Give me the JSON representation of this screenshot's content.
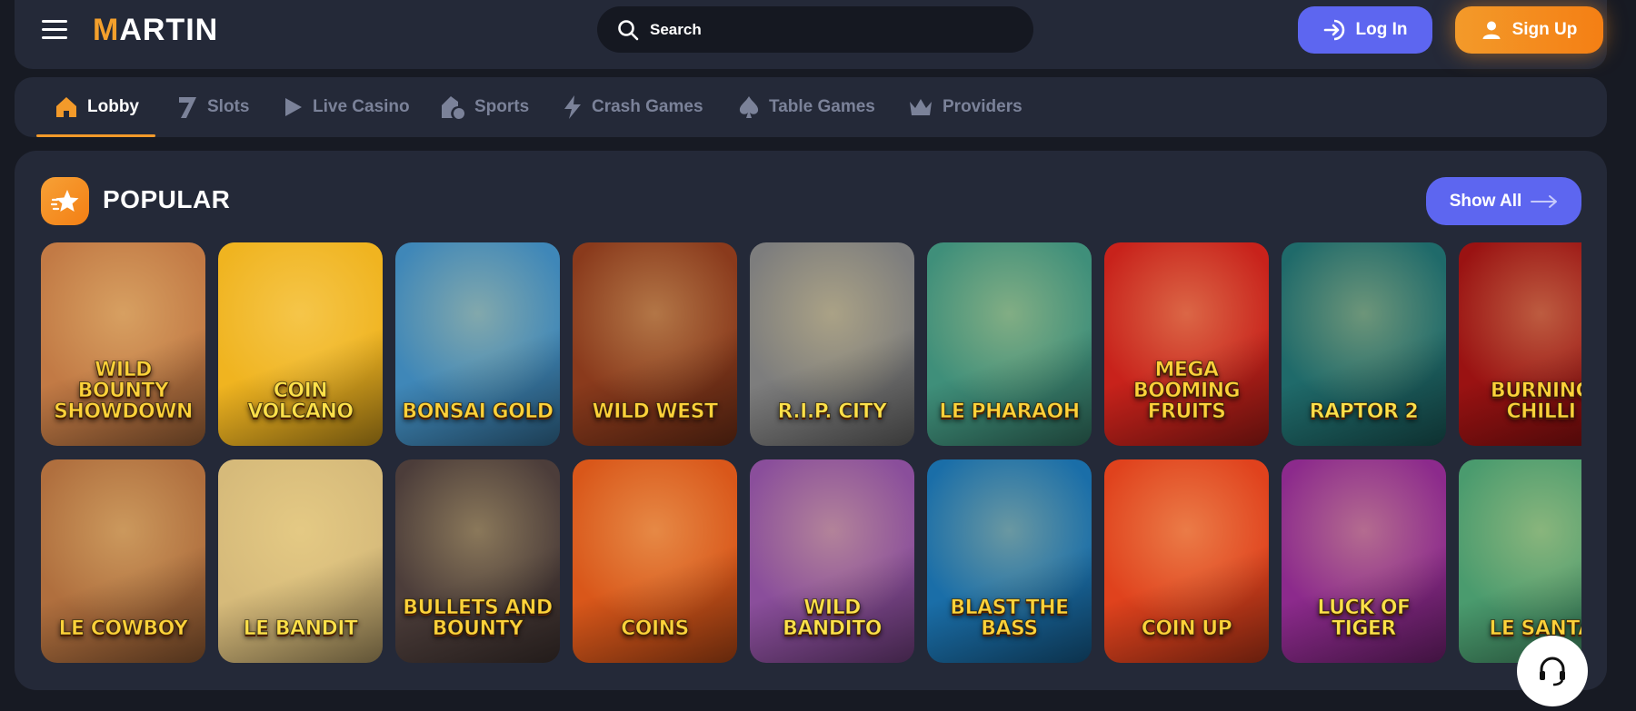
{
  "header": {
    "logo_prefix": "M",
    "logo_rest": "ARTIN",
    "search_placeholder": "Search",
    "login_label": "Log In",
    "signup_label": "Sign Up"
  },
  "nav": {
    "items": [
      {
        "label": "Lobby",
        "icon": "home-icon",
        "active": true
      },
      {
        "label": "Slots",
        "icon": "seven-icon"
      },
      {
        "label": "Live Casino",
        "icon": "play-icon"
      },
      {
        "label": "Sports",
        "icon": "sports-icon"
      },
      {
        "label": "Crash Games",
        "icon": "lightning-icon"
      },
      {
        "label": "Table Games",
        "icon": "spade-icon"
      },
      {
        "label": "Providers",
        "icon": "crown-icon"
      }
    ]
  },
  "section": {
    "title": "POPULAR",
    "icon": "star-icon",
    "show_all_label": "Show All"
  },
  "games": [
    {
      "title": "Wild Bounty Showdown",
      "color": "#c27a45"
    },
    {
      "title": "Coin Volcano",
      "color": "#f0b420"
    },
    {
      "title": "Bonsai Gold",
      "color": "#3f87b8"
    },
    {
      "title": "Wild West",
      "color": "#8a3a1c"
    },
    {
      "title": "R.I.P. City",
      "color": "#7d7d7d"
    },
    {
      "title": "Le Pharaoh",
      "color": "#3f8f7a"
    },
    {
      "title": "Mega Booming Fruits",
      "color": "#c8221b"
    },
    {
      "title": "Raptor 2",
      "color": "#1f6a6a"
    },
    {
      "title": "Burning Chilli",
      "color": "#9a1212"
    },
    {
      "title": "Le Cowboy",
      "color": "#b06f3e"
    },
    {
      "title": "Le Bandit",
      "color": "#d6ba7a"
    },
    {
      "title": "Bullets and Bounty",
      "color": "#4c3d3a"
    },
    {
      "title": "Coins",
      "color": "#d9571a"
    },
    {
      "title": "Wild Bandito",
      "color": "#8a4e9b"
    },
    {
      "title": "Blast The Bass",
      "color": "#1a6ea8"
    },
    {
      "title": "Coin Up",
      "color": "#e0421d"
    },
    {
      "title": "Luck of Tiger",
      "color": "#8c2a8c"
    },
    {
      "title": "Le Santa",
      "color": "#4a9b6e"
    }
  ]
}
